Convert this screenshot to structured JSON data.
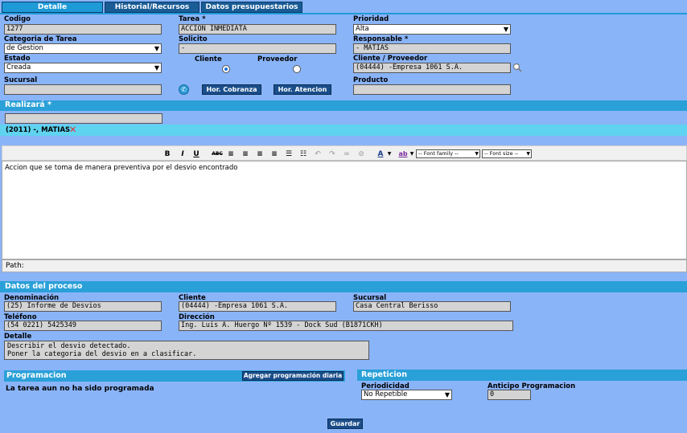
{
  "tabs": [
    "Detalle",
    "Historial/Recursos",
    "Datos presupuestarios"
  ],
  "form": {
    "codigo_label": "Codigo",
    "codigo": "1277",
    "tarea_label": "Tarea *",
    "tarea": "ACCION INMEDIATA",
    "prioridad_label": "Prioridad",
    "prioridad": "Alta",
    "categoria_label": "Categoria de Tarea",
    "categoria": "de Gestion",
    "solicito_label": "Solicito",
    "solicito": "-",
    "responsable_label": "Responsable *",
    "responsable": "- MATIAS",
    "estado_label": "Estado",
    "estado": "Creada",
    "cliente_label": "Cliente",
    "proveedor_label": "Proveedor",
    "cliente_proveedor_label": "Cliente / Proveedor",
    "cliente_proveedor": "(04444) -Empresa 1061 S.A.",
    "sucursal_label": "Sucursal",
    "sucursal": "",
    "producto_label": "Producto",
    "producto": "",
    "hor_cobranza": "Hor. Cobranza",
    "hor_atencion": "Hor. Atencion"
  },
  "realizara": {
    "title": "Realizará *",
    "input": "",
    "assigned": "(2011) -, MATIAS"
  },
  "editor": {
    "toolbar": {
      "bold": "B",
      "italic": "I",
      "underline": "U",
      "strike": "ABC",
      "font_family": "-- Font family --",
      "font_size": "-- Font size --"
    },
    "content": "Accion que se toma de manera preventiva por el desvio encontrado",
    "path_label": "Path:"
  },
  "proceso": {
    "title": "Datos del proceso",
    "denominacion_label": "Denominación",
    "denominacion": "(25) Informe de Desvios",
    "cliente_label": "Cliente",
    "cliente": "(04444) -Empresa 1061 S.A.",
    "sucursal_label": "Sucursal",
    "sucursal": "Casa Central Berisso",
    "telefono_label": "Teléfono",
    "telefono": "(54 0221) 5425349",
    "direccion_label": "Dirección",
    "direccion": "Ing. Luis A. Huergo Nº 1539 - Dock Sud (B1871CKH)",
    "detalle_label": "Detalle",
    "detalle_line1": "Describir el desvio detectado.",
    "detalle_line2": "Poner la categoria del desvio en a clasificar."
  },
  "programacion": {
    "title": "Programacion",
    "add_button": "Agregar programación diaria",
    "empty_text": "La tarea aun no ha sido programada"
  },
  "repeticion": {
    "title": "Repeticion",
    "periodicidad_label": "Periodicidad",
    "periodicidad": "No Repetible",
    "anticipo_label": "Anticipo Programacion",
    "anticipo": "0"
  },
  "save_button": "Guardar",
  "colors": {
    "page_bg": "#8ab4f8",
    "band": "#2aa0d8",
    "button": "#1a4e8a"
  }
}
